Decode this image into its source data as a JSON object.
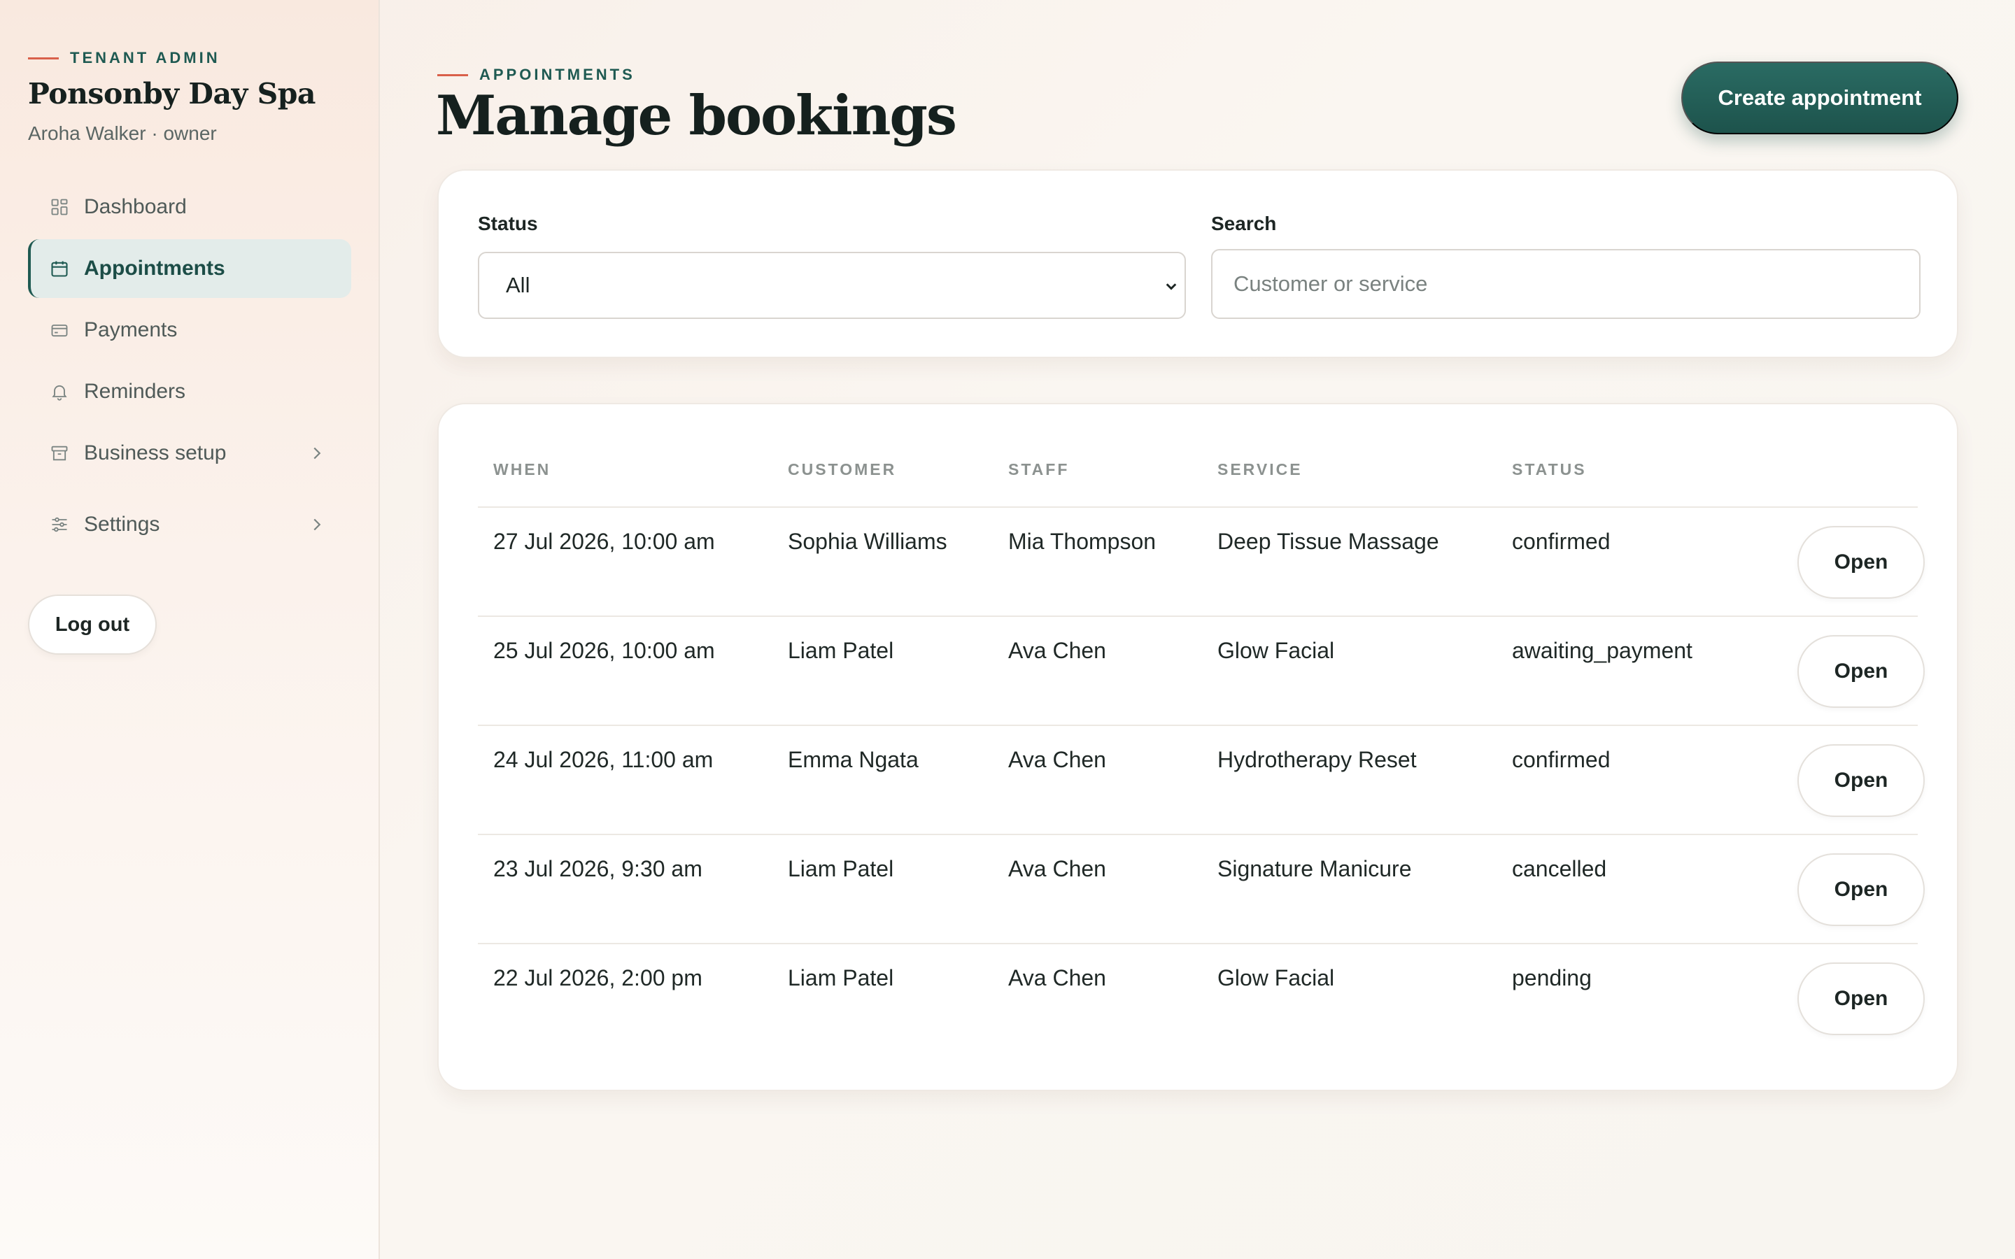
{
  "sidebar": {
    "eyebrow": "TENANT ADMIN",
    "business_name": "Ponsonby Day Spa",
    "user": "Aroha Walker · owner",
    "items": [
      {
        "label": "Dashboard",
        "icon": "dashboard-icon"
      },
      {
        "label": "Appointments",
        "icon": "calendar-icon",
        "active": true
      },
      {
        "label": "Payments",
        "icon": "credit-card-icon"
      },
      {
        "label": "Reminders",
        "icon": "bell-icon"
      },
      {
        "label": "Business setup",
        "icon": "store-icon",
        "has_submenu": true
      },
      {
        "label": "Settings",
        "icon": "sliders-icon",
        "has_submenu": true
      }
    ],
    "logout_label": "Log out"
  },
  "header": {
    "eyebrow": "APPOINTMENTS",
    "title": "Manage bookings",
    "create_label": "Create appointment"
  },
  "filters": {
    "status_label": "Status",
    "status_value": "All",
    "search_label": "Search",
    "search_placeholder": "Customer or service"
  },
  "table": {
    "columns": [
      "WHEN",
      "CUSTOMER",
      "STAFF",
      "SERVICE",
      "STATUS"
    ],
    "rows": [
      {
        "when": "27 Jul 2026, 10:00 am",
        "customer": "Sophia Williams",
        "staff": "Mia Thompson",
        "service": "Deep Tissue Massage",
        "status": "confirmed",
        "action": "Open"
      },
      {
        "when": "25 Jul 2026, 10:00 am",
        "customer": "Liam Patel",
        "staff": "Ava Chen",
        "service": "Glow Facial",
        "status": "awaiting_payment",
        "action": "Open"
      },
      {
        "when": "24 Jul 2026, 11:00 am",
        "customer": "Emma Ngata",
        "staff": "Ava Chen",
        "service": "Hydrotherapy Reset",
        "status": "confirmed",
        "action": "Open"
      },
      {
        "when": "23 Jul 2026, 9:30 am",
        "customer": "Liam Patel",
        "staff": "Ava Chen",
        "service": "Signature Manicure",
        "status": "cancelled",
        "action": "Open"
      },
      {
        "when": "22 Jul 2026, 2:00 pm",
        "customer": "Liam Patel",
        "staff": "Ava Chen",
        "service": "Glow Facial",
        "status": "pending",
        "action": "Open"
      }
    ]
  },
  "colors": {
    "accent": "#1f5a52",
    "accent_dash": "#d9604a",
    "active_nav_bg": "#e3ecea"
  }
}
